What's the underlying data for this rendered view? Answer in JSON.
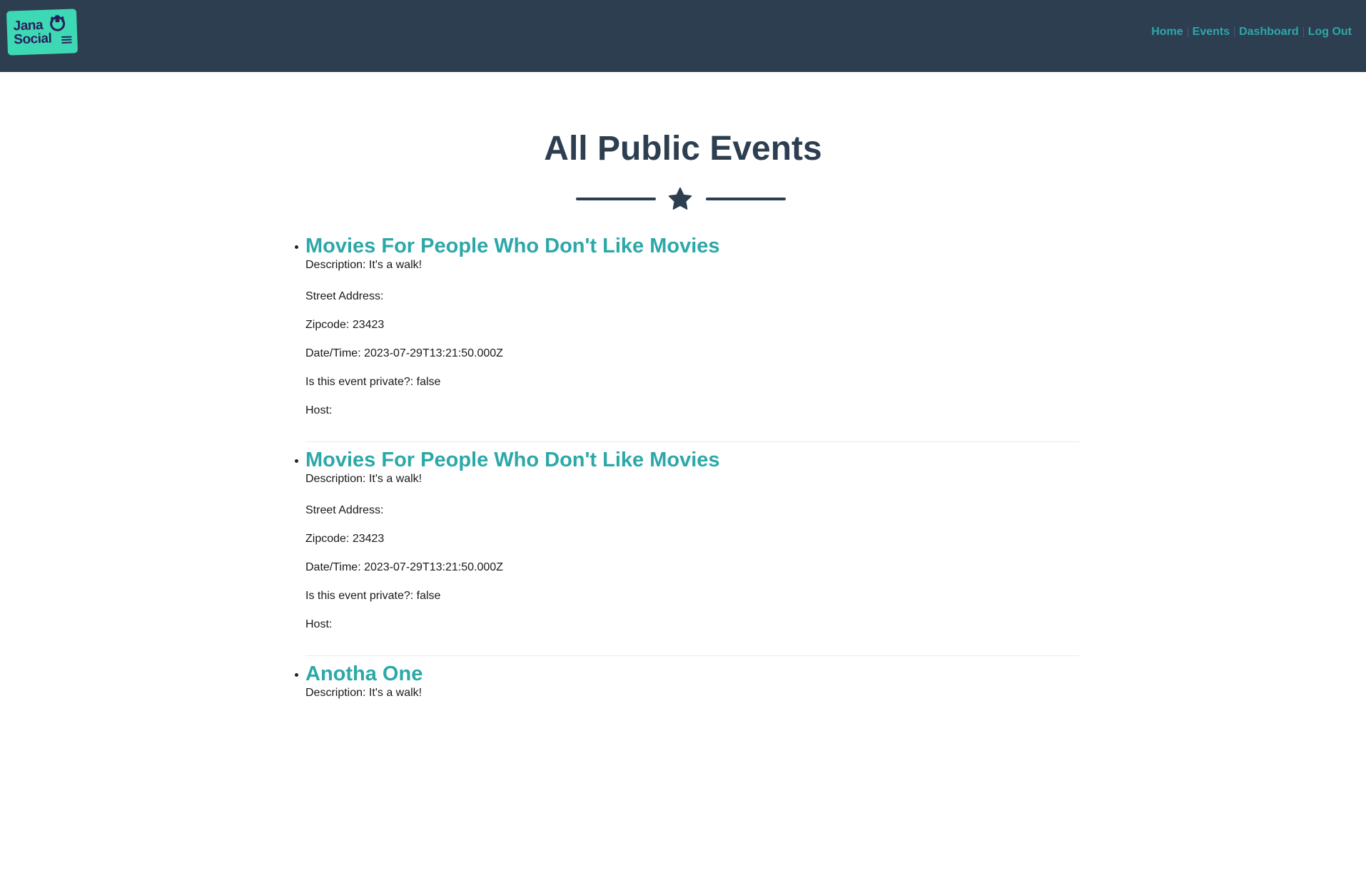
{
  "brand": {
    "logo_line1": "Jana",
    "logo_line2": "Social"
  },
  "nav": {
    "items": [
      {
        "label": "Home"
      },
      {
        "label": "Events"
      },
      {
        "label": "Dashboard"
      },
      {
        "label": "Log Out"
      }
    ]
  },
  "page": {
    "title": "All Public Events"
  },
  "events": [
    {
      "title": "Movies For People Who Don't Like Movies",
      "description": "Description: It's a walk!",
      "street": "Street Address:",
      "zipcode": "Zipcode: 23423",
      "datetime": "Date/Time: 2023-07-29T13:21:50.000Z",
      "private": "Is this event private?: false",
      "host": "Host:"
    },
    {
      "title": "Movies For People Who Don't Like Movies",
      "description": "Description: It's a walk!",
      "street": "Street Address:",
      "zipcode": "Zipcode: 23423",
      "datetime": "Date/Time: 2023-07-29T13:21:50.000Z",
      "private": "Is this event private?: false",
      "host": "Host:"
    },
    {
      "title": "Anotha One",
      "description": "Description: It's a walk!"
    }
  ],
  "colors": {
    "navbar": "#2c3e50",
    "accent": "#2ca8a8",
    "logo_bg": "#3dd9b4",
    "heading": "#2c3e50"
  },
  "icons": {
    "divider": "star-icon",
    "brand": "jana-social-logo"
  }
}
